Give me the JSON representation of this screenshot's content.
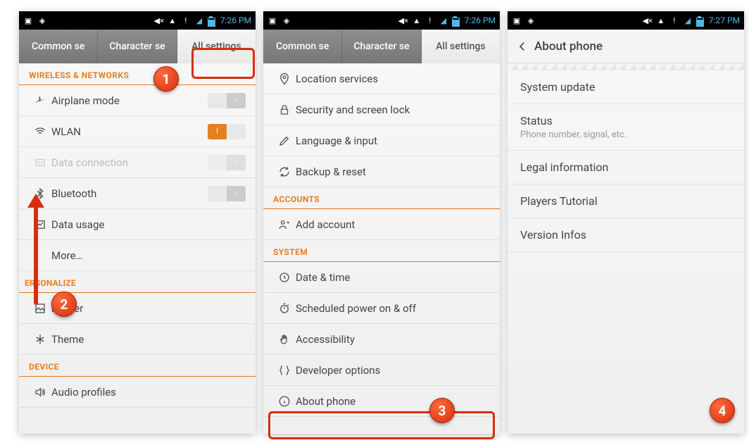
{
  "status": {
    "time1": "7:26 PM",
    "time2": "7:26 PM",
    "time3": "7:27 PM"
  },
  "tabs": {
    "common": "Common se",
    "character": "Character se",
    "all": "All settings"
  },
  "screen1": {
    "sections": {
      "wireless": "WIRELESS & NETWORKS",
      "personalize": "ERSONALIZE",
      "device": "DEVICE"
    },
    "items": {
      "airplane": "Airplane mode",
      "wlan": "WLAN",
      "data": "Data connection",
      "bluetooth": "Bluetooth",
      "usage": "Data usage",
      "more": "More…",
      "wallpaper": "llpaper",
      "theme": "Theme",
      "audio": "Audio profiles"
    }
  },
  "screen2": {
    "sections": {
      "accounts": "ACCOUNTS",
      "system": "SYSTEM"
    },
    "items": {
      "location": "Location services",
      "security": "Security and screen lock",
      "language": "Language & input",
      "backup": "Backup & reset",
      "addaccount": "Add account",
      "datetime": "Date & time",
      "scheduled": "Scheduled power on & off",
      "accessibility": "Accessibility",
      "developer": "Developer options",
      "about": "About phone"
    }
  },
  "screen3": {
    "title": "About phone",
    "items": {
      "update": "System update",
      "status": "Status",
      "status_sub": "Phone number, signal, etc.",
      "legal": "Legal information",
      "tutorial": "Players Tutorial",
      "version": "Version Infos"
    }
  },
  "callouts": {
    "c1": "1",
    "c2": "2",
    "c3": "3",
    "c4": "4"
  }
}
